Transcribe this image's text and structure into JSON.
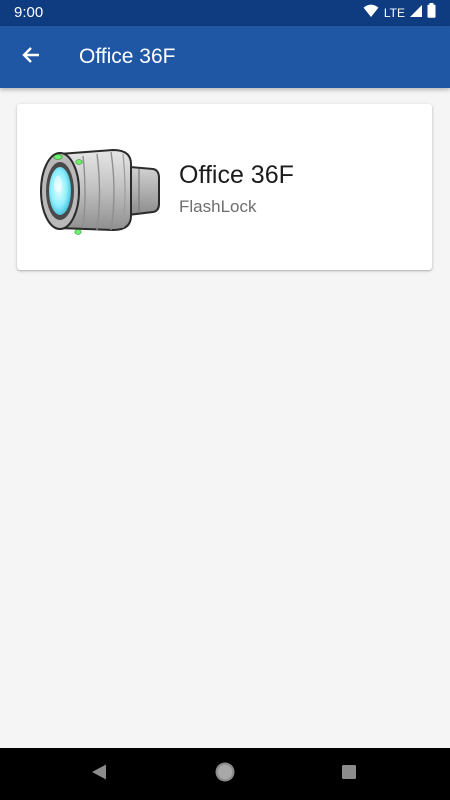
{
  "status_bar": {
    "time": "9:00",
    "network": "LTE",
    "icons": [
      "wifi-icon",
      "cellular-signal-icon",
      "battery-icon"
    ]
  },
  "app_bar": {
    "title": "Office 36F",
    "back_icon": "arrow-back-icon"
  },
  "lock_card": {
    "name": "Office 36F",
    "type": "FlashLock",
    "image_icon": "flashlock-cylinder-icon"
  },
  "nav_bar": {
    "icons": [
      "nav-back-icon",
      "nav-home-icon",
      "nav-recents-icon"
    ]
  },
  "colors": {
    "status_bar": "#0f3c80",
    "app_bar": "#2057a5",
    "background": "#f5f5f5",
    "card": "#ffffff",
    "title_text": "#1c1c1c",
    "subtitle_text": "#6e6e6e",
    "nav_bar": "#000000"
  }
}
